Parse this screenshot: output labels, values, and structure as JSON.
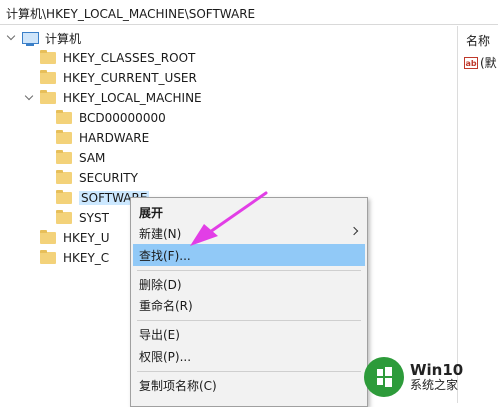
{
  "address_bar": {
    "path": "计算机\\HKEY_LOCAL_MACHINE\\SOFTWARE"
  },
  "tree": {
    "root_label": "计算机",
    "hives": [
      {
        "label": "HKEY_CLASSES_ROOT",
        "expanded": false
      },
      {
        "label": "HKEY_CURRENT_USER",
        "expanded": false
      },
      {
        "label": "HKEY_LOCAL_MACHINE",
        "expanded": true
      },
      {
        "label": "HKEY_U",
        "expanded": false
      },
      {
        "label": "HKEY_C",
        "expanded": false
      }
    ],
    "hklm_children": [
      {
        "label": "BCD00000000",
        "has_children": true
      },
      {
        "label": "HARDWARE",
        "has_children": true
      },
      {
        "label": "SAM",
        "has_children": true
      },
      {
        "label": "SECURITY",
        "has_children": false
      },
      {
        "label": "SOFTWARE",
        "has_children": true,
        "selected": true
      },
      {
        "label": "SYST",
        "has_children": true
      }
    ]
  },
  "values_pane": {
    "header_name": "名称",
    "first_value": "(默"
  },
  "context_menu": {
    "items": [
      {
        "label": "展开",
        "bold": true
      },
      {
        "label": "新建(N)",
        "submenu": true
      },
      {
        "label": "查找(F)...",
        "highlighted": true
      },
      {
        "label": "删除(D)"
      },
      {
        "label": "重命名(R)"
      },
      {
        "label": "导出(E)"
      },
      {
        "label": "权限(P)..."
      },
      {
        "label": "复制项名称(C)"
      }
    ]
  },
  "watermark": {
    "brand": "Win10",
    "subtitle": "系统之家"
  },
  "colors": {
    "highlight": "#91c9f7",
    "selection": "#cce8ff",
    "arrow": "#e23ee6",
    "folder": "#f3d27a",
    "watermark_green": "#2d9b3a"
  }
}
